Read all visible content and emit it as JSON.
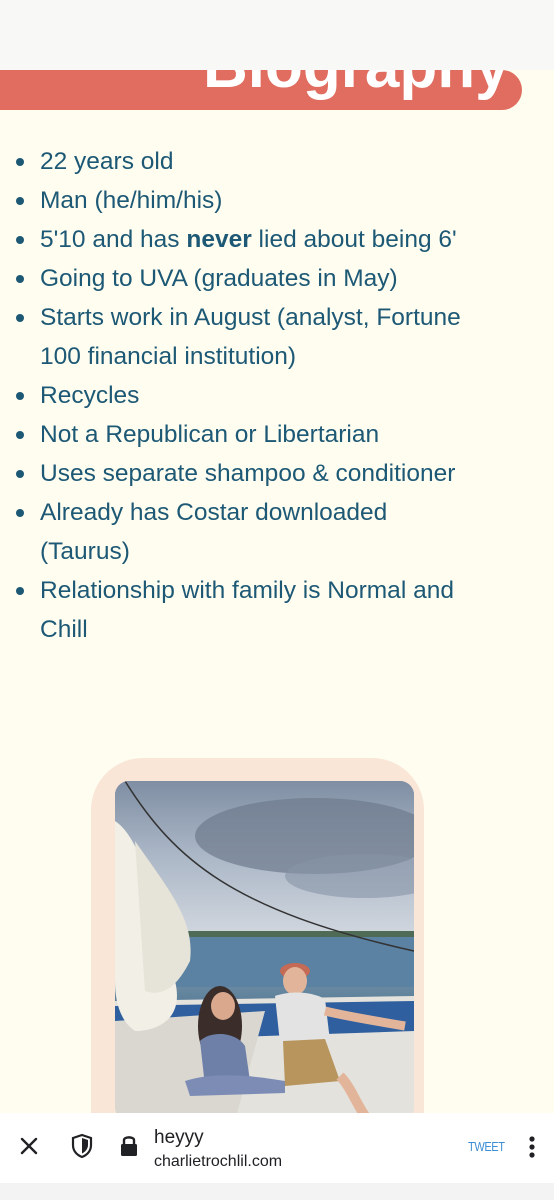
{
  "page": {
    "banner_title": "Biography"
  },
  "bio": {
    "items": [
      {
        "text": "22 years old"
      },
      {
        "text": "Man (he/him/his)"
      },
      {
        "pre": "5'10 and has ",
        "bold": "never",
        "post": " lied about being 6'"
      },
      {
        "text": "Going to UVA (graduates in May)"
      },
      {
        "text": "Starts work in August (analyst, Fortune 100 financial institution)"
      },
      {
        "text": "Recycles"
      },
      {
        "text": "Not a Republican or Libertarian"
      },
      {
        "text": "Uses separate shampoo & conditioner"
      },
      {
        "text": "Already has Costar downloaded (Taurus)"
      },
      {
        "text": "Relationship with family is Normal and Chill"
      }
    ]
  },
  "bottom_bar": {
    "page_title": "heyyy",
    "url": "charlietrochlil.com",
    "tweet_label": "TWEET",
    "icons": [
      "close-icon",
      "shield-icon",
      "lock-icon",
      "more-vert-icon"
    ]
  },
  "colors": {
    "background": "#fefdf0",
    "banner": "#e06d5f",
    "text": "#1d5875",
    "photo_frame": "#fae6d7",
    "tweet": "#3e8ed6"
  }
}
